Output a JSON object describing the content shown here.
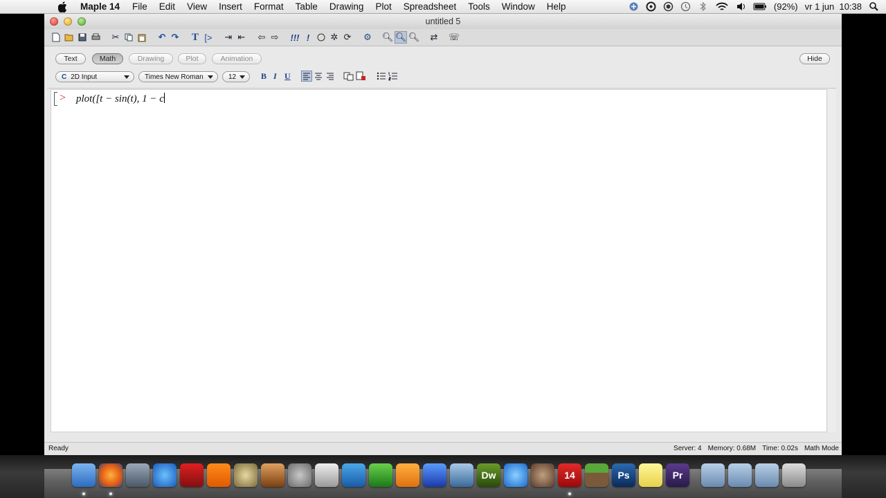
{
  "menubar": {
    "app_name": "Maple 14",
    "menus": [
      "File",
      "Edit",
      "View",
      "Insert",
      "Format",
      "Table",
      "Drawing",
      "Plot",
      "Spreadsheet",
      "Tools",
      "Window",
      "Help"
    ],
    "battery": "(92%)",
    "clock": "vr 1 jun  10:38"
  },
  "window": {
    "title": "untitled 5"
  },
  "context": {
    "modes": [
      "Text",
      "Math",
      "Drawing",
      "Plot",
      "Animation"
    ],
    "active_mode": "Math",
    "hide_label": "Hide",
    "input_style": "2D Input",
    "input_style_prefix": "C",
    "font": "Times New Roman",
    "size": "12",
    "bold": "B",
    "italic": "I",
    "underline": "U"
  },
  "document": {
    "prompt": ">",
    "input_text": "plot([t − sin(t), 1 − c"
  },
  "status": {
    "ready": "Ready",
    "server": "Server: 4",
    "memory": "Memory: 0.68M",
    "time": "Time: 0.02s",
    "mode": "Math Mode"
  },
  "dock": {
    "items": [
      "finder-icon",
      "firefox-icon",
      "photo-icon",
      "itunes-icon",
      "photobooth-icon",
      "vlc-icon",
      "imovie-icon",
      "garageband-icon",
      "system-preferences-icon",
      "calculator-icon",
      "word-icon",
      "excel-icon",
      "powerpoint-icon",
      "entourage-icon",
      "xcode-icon",
      "dreamweaver-icon",
      "frontrow-icon",
      "itunes-record-icon",
      "maple-icon",
      "minecraft-icon",
      "photoshop-icon",
      "stickies-icon",
      "premiere-icon",
      "applications-folder-icon",
      "documents-folder-icon",
      "downloads-folder-icon",
      "trash-icon"
    ],
    "labels": {
      "dreamweaver": "Dw",
      "maple": "14",
      "photoshop": "Ps",
      "premiere": "Pr"
    }
  }
}
